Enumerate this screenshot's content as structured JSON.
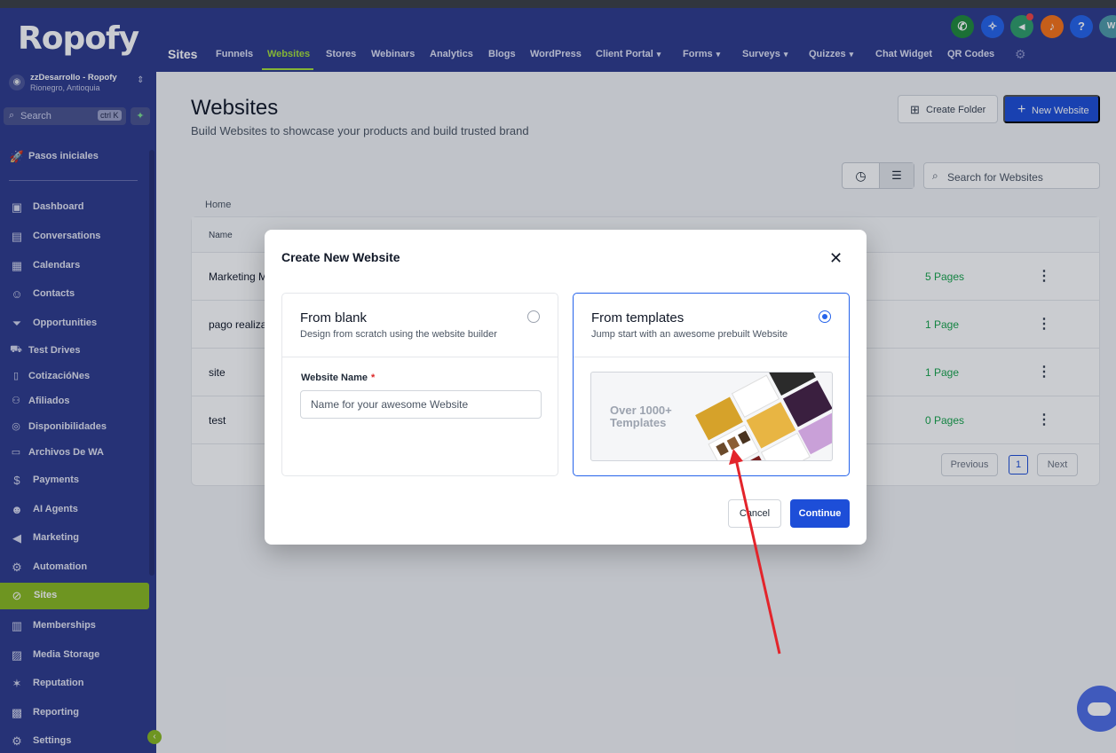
{
  "app": {
    "logo": "Ropofy"
  },
  "account": {
    "name": "zzDesarrollo - Ropofy",
    "location": "Rionegro, Antioquia"
  },
  "sidebar": {
    "search_placeholder": "Search",
    "search_shortcut": "ctrl K",
    "items": [
      {
        "label": "Pasos iniciales",
        "icon": "rocket-icon"
      },
      {
        "label": "Dashboard",
        "icon": "dashboard-icon"
      },
      {
        "label": "Conversations",
        "icon": "chat-icon"
      },
      {
        "label": "Calendars",
        "icon": "calendar-icon"
      },
      {
        "label": "Contacts",
        "icon": "contacts-icon"
      },
      {
        "label": "Opportunities",
        "icon": "filter-icon"
      },
      {
        "label": "Test Drives",
        "icon": "car-icon"
      },
      {
        "label": "CotizacióNes",
        "icon": "document-icon"
      },
      {
        "label": "Afiliados",
        "icon": "users-icon"
      },
      {
        "label": "Disponibilidades",
        "icon": "coins-icon"
      },
      {
        "label": "Archivos De WA",
        "icon": "files-icon"
      },
      {
        "label": "Payments",
        "icon": "dollar-icon"
      },
      {
        "label": "AI Agents",
        "icon": "robot-icon"
      },
      {
        "label": "Marketing",
        "icon": "megaphone-icon"
      },
      {
        "label": "Automation",
        "icon": "automation-icon"
      },
      {
        "label": "Sites",
        "icon": "globe-icon"
      },
      {
        "label": "Memberships",
        "icon": "membership-icon"
      },
      {
        "label": "Media Storage",
        "icon": "image-icon"
      },
      {
        "label": "Reputation",
        "icon": "star-icon"
      },
      {
        "label": "Reporting",
        "icon": "chart-icon"
      },
      {
        "label": "Settings",
        "icon": "gear-icon"
      }
    ]
  },
  "header": {
    "section": "Sites",
    "tabs": [
      "Funnels",
      "Websites",
      "Stores",
      "Webinars",
      "Analytics",
      "Blogs",
      "WordPress",
      "Client Portal",
      "Forms",
      "Surveys",
      "Quizzes",
      "Chat Widget",
      "QR Codes"
    ],
    "active_tab": "Websites",
    "avatar_initials": "WI",
    "help_icon": "?"
  },
  "page": {
    "title": "Websites",
    "subtitle": "Build Websites to showcase your products and build trusted brand",
    "create_folder": "Create Folder",
    "new_website": "New Website",
    "search_placeholder": "Search for Websites",
    "breadcrumb": "Home",
    "table": {
      "header_name": "Name",
      "rows": [
        {
          "name": "Marketing M",
          "pages": "5 Pages"
        },
        {
          "name": "pago realiza",
          "pages": "1 Page"
        },
        {
          "name": "site",
          "pages": "1 Page"
        },
        {
          "name": "test",
          "pages": "0 Pages"
        }
      ]
    },
    "pager": {
      "prev": "Previous",
      "current": "1",
      "next": "Next"
    }
  },
  "modal": {
    "title": "Create New Website",
    "blank": {
      "title": "From blank",
      "desc": "Design from scratch using the website builder",
      "selected": false
    },
    "templates": {
      "title": "From templates",
      "desc": "Jump start with an awesome prebuilt Website",
      "selected": true,
      "preview_line1": "Over 1000+",
      "preview_line2": "Templates"
    },
    "field_label": "Website Name",
    "field_required": "*",
    "field_placeholder": "Name for your awesome Website",
    "field_value": "",
    "cancel": "Cancel",
    "continue": "Continue"
  },
  "colors": {
    "sidebar_bg": "#2e3a8c",
    "active_green": "#8ab91f",
    "primary_blue": "#1d4ed8",
    "pages_green": "#16a34a",
    "annotation_red": "#e3242b"
  }
}
